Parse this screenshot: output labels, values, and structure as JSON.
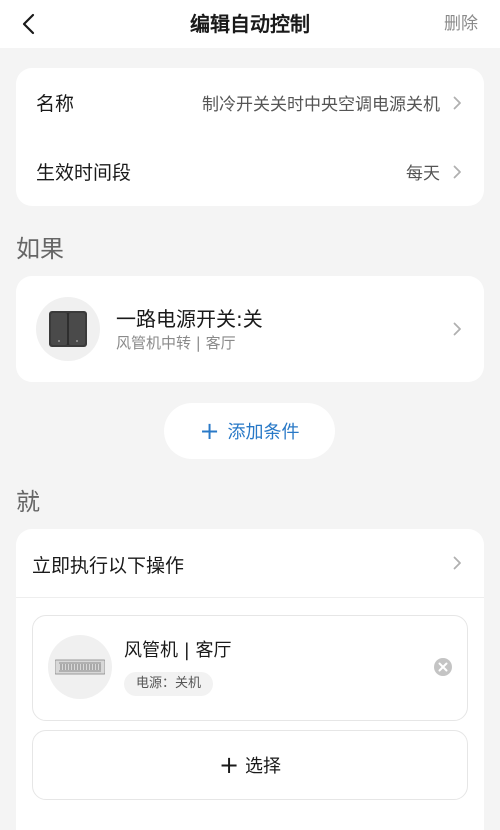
{
  "header": {
    "title": "编辑自动控制",
    "delete_label": "删除"
  },
  "settings": {
    "name_label": "名称",
    "name_value": "制冷开关关时中央空调电源关机",
    "period_label": "生效时间段",
    "period_value": "每天"
  },
  "if_section": {
    "title": "如果",
    "condition_title": "一路电源开关:关",
    "condition_sub": "风管机中转 | 客厅",
    "add_label": "添加条件"
  },
  "then_section": {
    "title": "就",
    "execute_label": "立即执行以下操作",
    "action_title": "风管机 | 客厅",
    "action_tag": "电源：关机",
    "select_label": "选择"
  },
  "colors": {
    "accent": "#2979c7",
    "background": "#f4f4f4"
  }
}
